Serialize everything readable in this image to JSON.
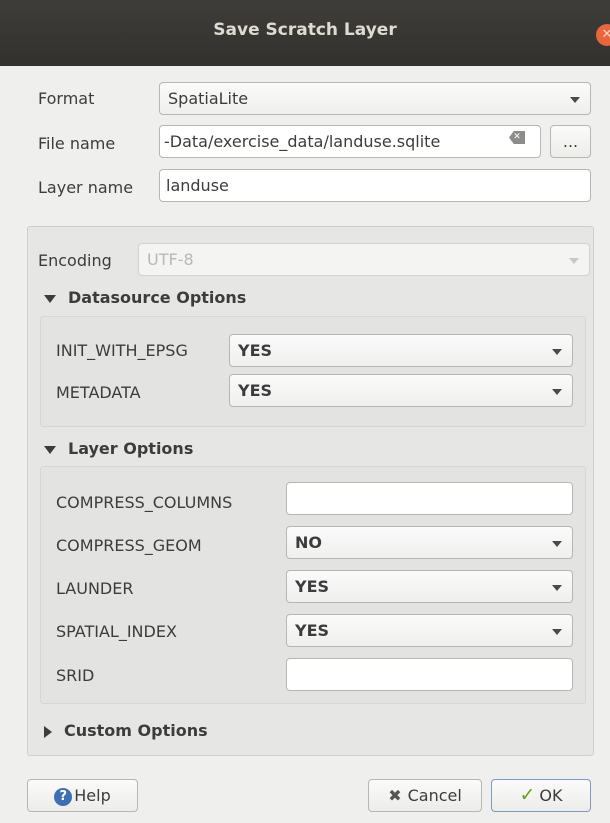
{
  "window": {
    "title": "Save Scratch Layer"
  },
  "form": {
    "format_label": "Format",
    "format_value": "SpatiaLite",
    "file_name_label": "File name",
    "file_name_value": "-Data/exercise_data/landuse.sqlite",
    "browse_label": "...",
    "layer_name_label": "Layer name",
    "layer_name_value": "landuse"
  },
  "encoding": {
    "label": "Encoding",
    "value": "UTF-8"
  },
  "datasource_options": {
    "title": "Datasource Options",
    "rows": [
      {
        "label": "INIT_WITH_EPSG",
        "value": "YES"
      },
      {
        "label": "METADATA",
        "value": "YES"
      }
    ]
  },
  "layer_options": {
    "title": "Layer Options",
    "rows": [
      {
        "label": "COMPRESS_COLUMNS",
        "value": ""
      },
      {
        "label": "COMPRESS_GEOM",
        "value": "NO"
      },
      {
        "label": "LAUNDER",
        "value": "YES"
      },
      {
        "label": "SPATIAL_INDEX",
        "value": "YES"
      },
      {
        "label": "SRID",
        "value": ""
      }
    ]
  },
  "custom_options": {
    "title": "Custom Options"
  },
  "buttons": {
    "help": "Help",
    "cancel": "Cancel",
    "ok": "OK"
  },
  "icons": {
    "help": "help-icon",
    "cancel": "close-icon",
    "ok": "checkmark-icon",
    "clear": "clear-text-icon"
  }
}
